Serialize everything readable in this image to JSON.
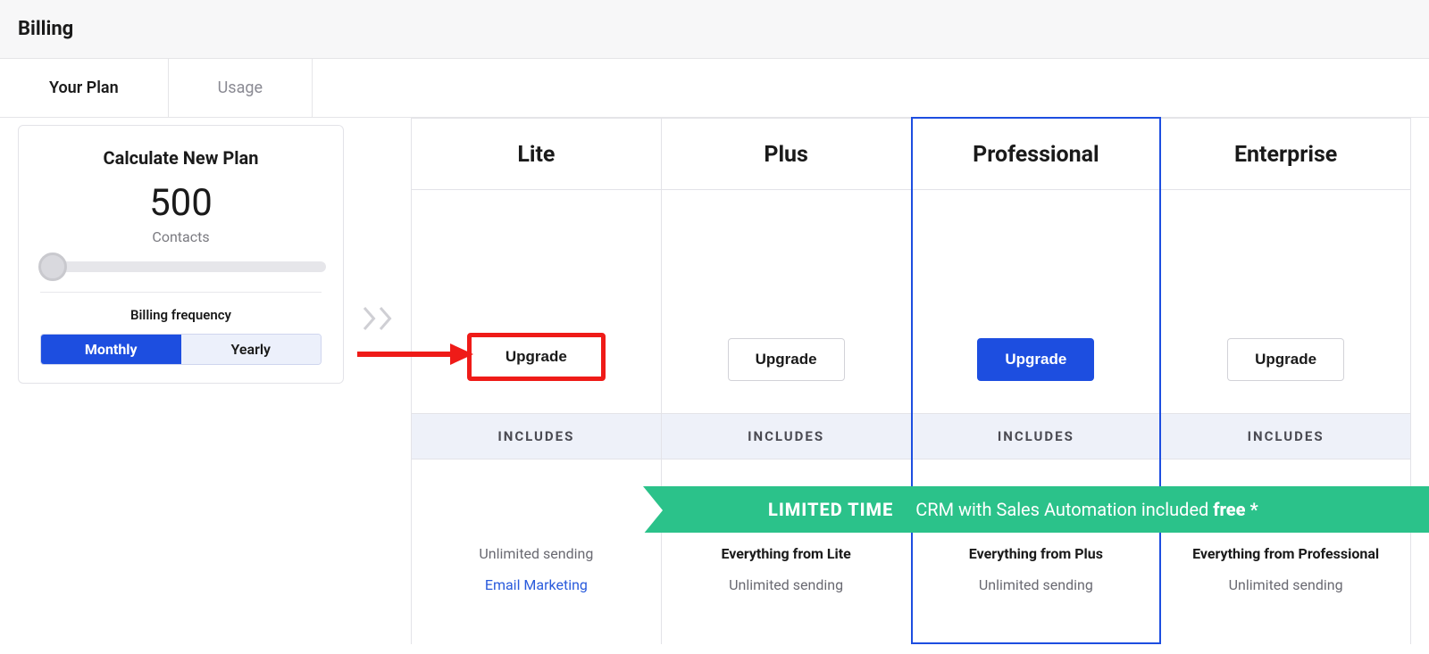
{
  "header": {
    "title": "Billing"
  },
  "tabs": [
    {
      "label": "Your Plan",
      "active": true
    },
    {
      "label": "Usage",
      "active": false
    }
  ],
  "calculator": {
    "title": "Calculate New Plan",
    "value": "500",
    "unit": "Contacts",
    "freq_label": "Billing frequency",
    "options": {
      "monthly": "Monthly",
      "yearly": "Yearly"
    },
    "active_option": "monthly"
  },
  "includes_label": "INCLUDES",
  "banner": {
    "lead": "LIMITED TIME",
    "text": "CRM with Sales Automation included ",
    "tail": "free *"
  },
  "plans": [
    {
      "name": "Lite",
      "cta": "Upgrade",
      "featured": false,
      "highlight_btn": true,
      "features": [
        {
          "text": "Unlimited sending",
          "style": "muted"
        },
        {
          "text": "Email Marketing",
          "style": "link"
        }
      ]
    },
    {
      "name": "Plus",
      "cta": "Upgrade",
      "featured": false,
      "highlight_btn": false,
      "features": [
        {
          "text": "Everything from Lite",
          "style": "bold"
        },
        {
          "text": "Unlimited sending",
          "style": "muted"
        }
      ]
    },
    {
      "name": "Professional",
      "cta": "Upgrade",
      "featured": true,
      "highlight_btn": false,
      "features": [
        {
          "text": "Everything from Plus",
          "style": "bold"
        },
        {
          "text": "Unlimited sending",
          "style": "muted"
        }
      ]
    },
    {
      "name": "Enterprise",
      "cta": "Upgrade",
      "featured": false,
      "highlight_btn": false,
      "features": [
        {
          "text": "Everything from Professional",
          "style": "bold"
        },
        {
          "text": "Unlimited sending",
          "style": "muted"
        }
      ]
    }
  ]
}
